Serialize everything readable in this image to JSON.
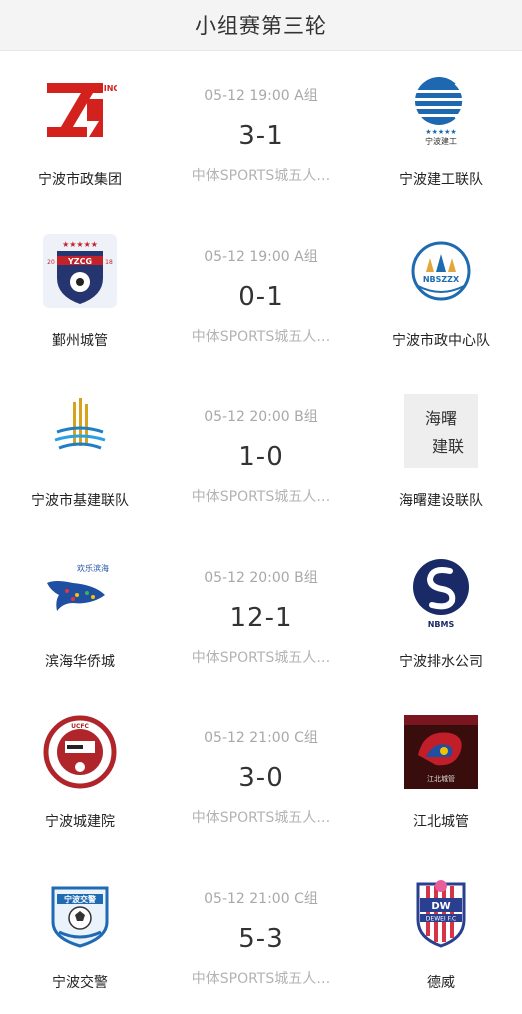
{
  "header": {
    "title": "小组赛第三轮"
  },
  "matches": [
    {
      "time": "05-12 19:00 A组",
      "score": "3-1",
      "venue": "中体SPORTS城五人…",
      "home": {
        "name": "宁波市政集团",
        "logo_text": "NINGI",
        "icon": "ningbo-municipal-logo"
      },
      "away": {
        "name": "宁波建工联队",
        "logo_text": "宁波建工",
        "icon": "ningbo-construction-logo"
      }
    },
    {
      "time": "05-12 19:00 A组",
      "score": "0-1",
      "venue": "中体SPORTS城五人…",
      "home": {
        "name": "鄞州城管",
        "logo_text": "YZCG",
        "logo_num_left": "20",
        "logo_num_right": "18",
        "icon": "yzcg-shield-logo"
      },
      "away": {
        "name": "宁波市政中心队",
        "logo_text": "NBSZZX",
        "icon": "nbszzx-logo"
      }
    },
    {
      "time": "05-12 20:00 B组",
      "score": "1-0",
      "venue": "中体SPORTS城五人…",
      "home": {
        "name": "宁波市基建联队",
        "icon": "infrastructure-logo"
      },
      "away": {
        "name": "海曙建设联队",
        "logo_text_top": "海曙",
        "logo_text_bottom": "建联",
        "icon": "haishu-calligraphy-logo"
      }
    },
    {
      "time": "05-12 20:00 B组",
      "score": "12-1",
      "venue": "中体SPORTS城五人…",
      "home": {
        "name": "滨海华侨城",
        "logo_text": "欢乐滨海",
        "icon": "whale-logo"
      },
      "away": {
        "name": "宁波排水公司",
        "logo_text": "NBMS",
        "icon": "drainage-s-logo"
      }
    },
    {
      "time": "05-12 21:00 C组",
      "score": "3-0",
      "venue": "中体SPORTS城五人…",
      "home": {
        "name": "宁波城建院",
        "logo_text": "UCFC",
        "icon": "ucfc-badge-logo"
      },
      "away": {
        "name": "江北城管",
        "logo_text": "江北城管",
        "icon": "jiangbei-logo"
      }
    },
    {
      "time": "05-12 21:00 C组",
      "score": "5-3",
      "venue": "中体SPORTS城五人…",
      "home": {
        "name": "宁波交警",
        "logo_text": "宁波交警",
        "icon": "traffic-police-logo"
      },
      "away": {
        "name": "德威",
        "logo_text": "DW",
        "logo_sub": "DEWEI F.C",
        "icon": "dewei-fc-logo"
      }
    }
  ]
}
